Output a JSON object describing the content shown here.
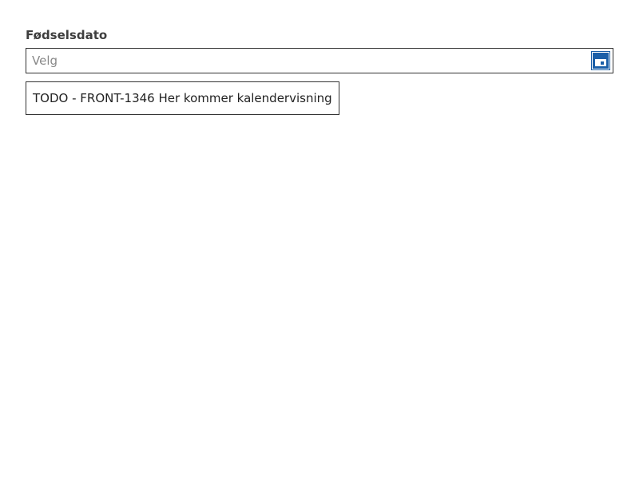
{
  "date_field": {
    "label": "Fødselsdato",
    "value": "",
    "placeholder": "Velg",
    "calendar_icon": "calendar-icon",
    "accent_color": "#1b5fa8"
  },
  "todo_box": {
    "text": "TODO - FRONT-1346 Her kommer kalendervisning"
  }
}
